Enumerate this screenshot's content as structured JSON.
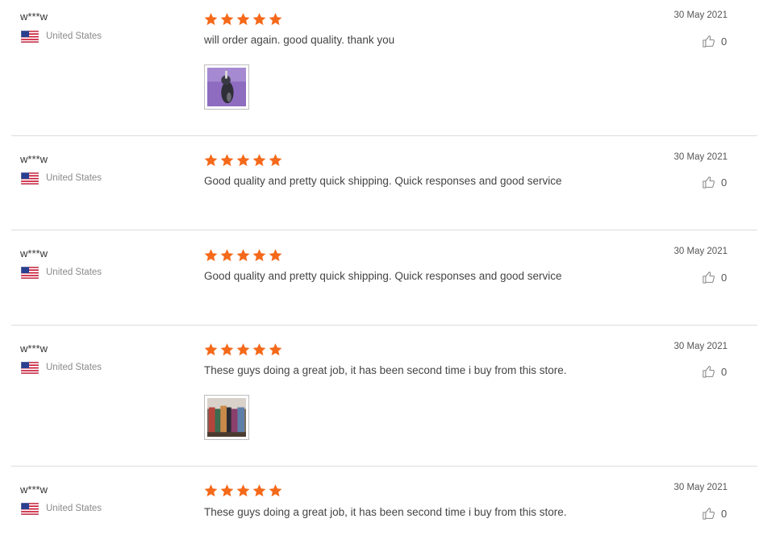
{
  "colors": {
    "star": "#f5691a",
    "separator": "#dcdcdc",
    "country_text": "#8a8a8a"
  },
  "reviews": [
    {
      "reviewer": "w***w",
      "country": "United States",
      "flag_icon": "us-flag-icon",
      "rating": 5,
      "text": "will order again. good quality. thank you",
      "date": "30 May 2021",
      "likes": "0",
      "has_photo": true,
      "photo_icon": "product-photo-thumbnail"
    },
    {
      "reviewer": "w***w",
      "country": "United States",
      "flag_icon": "us-flag-icon",
      "rating": 5,
      "text": "Good quality and pretty quick shipping. Quick responses and good service",
      "date": "30 May 2021",
      "likes": "0",
      "has_photo": false
    },
    {
      "reviewer": "w***w",
      "country": "United States",
      "flag_icon": "us-flag-icon",
      "rating": 5,
      "text": "Good quality and pretty quick shipping. Quick responses and good service",
      "date": "30 May 2021",
      "likes": "0",
      "has_photo": false
    },
    {
      "reviewer": "w***w",
      "country": "United States",
      "flag_icon": "us-flag-icon",
      "rating": 5,
      "text": "These guys doing a great job, it has been second time i buy from this store.",
      "date": "30 May 2021",
      "likes": "0",
      "has_photo": true,
      "photo_icon": "product-photo-thumbnail"
    },
    {
      "reviewer": "w***w",
      "country": "United States",
      "flag_icon": "us-flag-icon",
      "rating": 5,
      "text": "These guys doing a great job, it has been second time i buy from this store.",
      "date": "30 May 2021",
      "likes": "0",
      "has_photo": false
    }
  ]
}
